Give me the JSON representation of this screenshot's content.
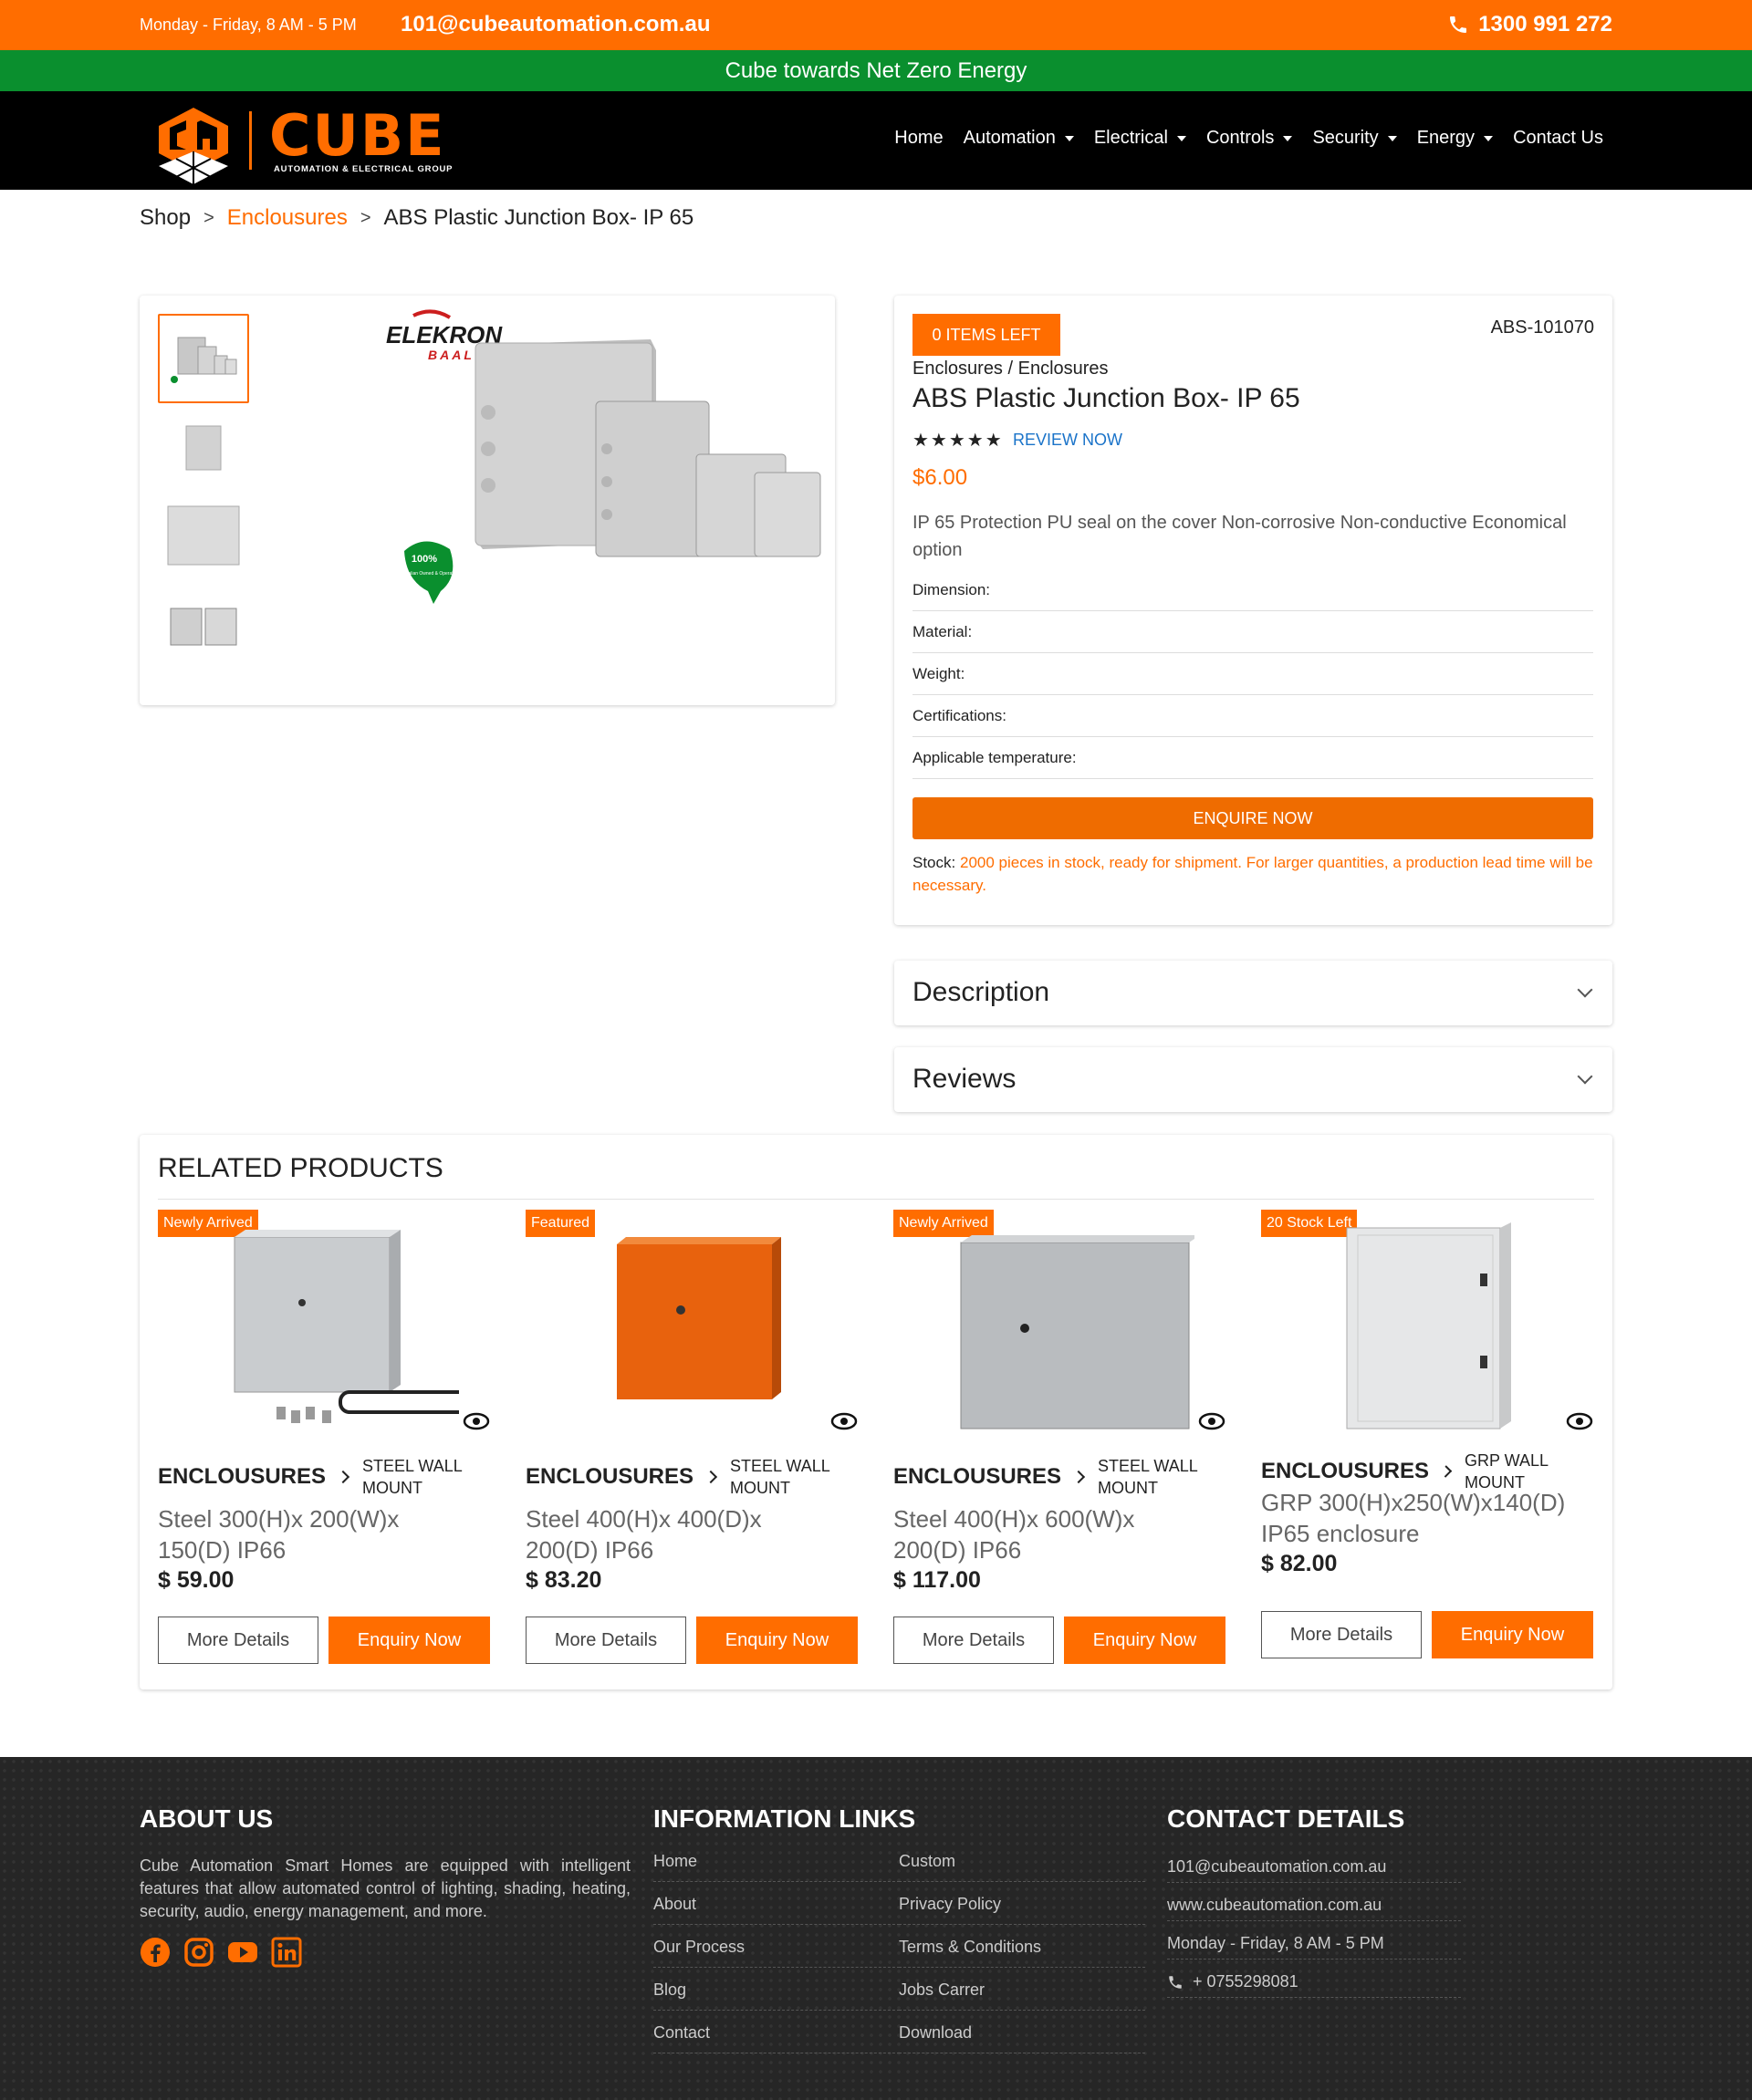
{
  "topbar": {
    "hours": "Monday - Friday, 8 AM - 5 PM",
    "email": "101@cubeautomation.com.au",
    "phone": "1300 991 272"
  },
  "banner": "Cube towards Net Zero Energy",
  "logo": {
    "word": "CUBE",
    "tagline": "AUTOMATION & ELECTRICAL GROUP"
  },
  "nav": {
    "items": [
      {
        "label": "Home",
        "dropdown": false
      },
      {
        "label": "Automation",
        "dropdown": true
      },
      {
        "label": "Electrical",
        "dropdown": true
      },
      {
        "label": "Controls",
        "dropdown": true
      },
      {
        "label": "Security",
        "dropdown": true
      },
      {
        "label": "Energy",
        "dropdown": true
      },
      {
        "label": "Contact Us",
        "dropdown": false
      }
    ]
  },
  "breadcrumb": {
    "shop": "Shop",
    "category": "Enclousures",
    "current": "ABS Plastic Junction Box- IP 65",
    "sep": ">"
  },
  "gallery": {
    "brand": "ELEKRON",
    "brand_sub": "BAAL",
    "badge": "100%",
    "badge_sub": "Australian Owned & Operated"
  },
  "product": {
    "stock_badge": "0 ITEMS LEFT",
    "sku": "ABS-101070",
    "category": "Enclosures / Enclosures",
    "title": "ABS Plastic Junction Box- IP 65",
    "stars": "★★★★★",
    "review_link": "REVIEW NOW",
    "price": "$6.00",
    "description": "IP 65 Protection PU seal on the cover Non-corrosive Non-conductive Economical option",
    "specs": [
      "Dimension:",
      "Material:",
      "Weight:",
      "Certifications:",
      "Applicable temperature:"
    ],
    "enquire_label": "ENQUIRE NOW",
    "stock_label": "Stock:",
    "stock_text": "2000 pieces in stock, ready for shipment. For larger quantities, a production lead time will be necessary."
  },
  "accordions": [
    "Description",
    "Reviews"
  ],
  "related": {
    "title": "RELATED PRODUCTS",
    "more_label": "More Details",
    "enquiry_label": "Enquiry Now",
    "products": [
      {
        "badge": "Newly Arrived",
        "category": "ENCLOUSURES",
        "subcategory": "STEEL WALL MOUNT",
        "name": "Steel 300(H)x 200(W)x 150(D) IP66",
        "price": "$ 59.00",
        "color": "#c9cccf"
      },
      {
        "badge": "Featured",
        "category": "ENCLOUSURES",
        "subcategory": "STEEL WALL MOUNT",
        "name": "Steel 400(H)x 400(D)x 200(D) IP66",
        "price": "$ 83.20",
        "color": "#e8620d"
      },
      {
        "badge": "Newly Arrived",
        "category": "ENCLOUSURES",
        "subcategory": "STEEL WALL MOUNT",
        "name": "Steel 400(H)x 600(W)x 200(D) IP66",
        "price": "$ 117.00",
        "color": "#b9bcbf"
      },
      {
        "badge": "20 Stock Left",
        "category": "ENCLOUSURES",
        "subcategory": "GRP WALL MOUNT",
        "name": "GRP 300(H)x250(W)x140(D) IP65 enclosure",
        "price": "$ 82.00",
        "color": "#e6e7e8"
      }
    ]
  },
  "footer": {
    "about_title": "ABOUT US",
    "about_text": "Cube Automation Smart Homes are equipped with intelligent features that allow automated control of lighting, shading, heating, security, audio, energy management, and more.",
    "links_title": "INFORMATION LINKS",
    "links_left": [
      "Home",
      "About",
      "Our Process",
      "Blog",
      "Contact"
    ],
    "links_right": [
      "Custom",
      "Privacy Policy",
      "Terms & Conditions",
      "Jobs Carrer",
      "Download"
    ],
    "contact_title": "CONTACT DETAILS",
    "contact": {
      "email": "101@cubeautomation.com.au",
      "website": "www.cubeautomation.com.au",
      "hours": "Monday - Friday, 8 AM - 5 PM",
      "phone": "+ 0755298081"
    }
  },
  "colors": {
    "accent": "#ff6d00",
    "green": "#0a8f2e",
    "footer_bg": "#262626"
  }
}
